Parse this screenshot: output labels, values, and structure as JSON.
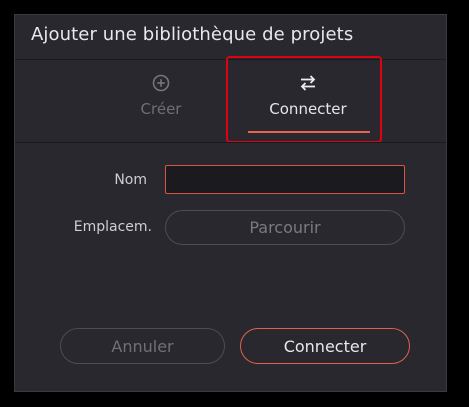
{
  "dialog": {
    "title": "Ajouter une bibliothèque de projets"
  },
  "tabs": [
    {
      "label": "Créer",
      "icon": "plus-circle-icon",
      "active": false
    },
    {
      "label": "Connecter",
      "icon": "swap-arrows-icon",
      "active": true
    }
  ],
  "form": {
    "name_label": "Nom",
    "name_value": "",
    "location_label": "Emplacem.",
    "browse_label": "Parcourir"
  },
  "footer": {
    "cancel_label": "Annuler",
    "connect_label": "Connecter"
  },
  "colors": {
    "accent": "#e8624f",
    "highlight": "#e00010",
    "dialog_bg": "#28282e"
  }
}
